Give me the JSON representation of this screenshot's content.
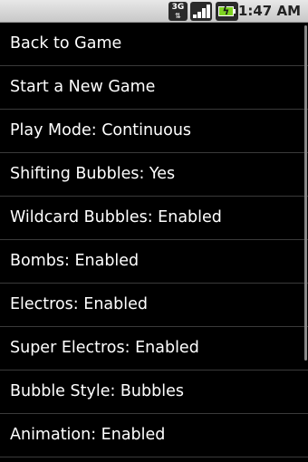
{
  "status_bar": {
    "network_label": "3G",
    "network_arrows": "⇅",
    "signal_level": 1.0,
    "battery_level": 1.0,
    "battery_charging_glyph": "ϟ",
    "time": "1:47 AM",
    "icons": [
      "network-3g-icon",
      "signal-strength-icon",
      "battery-charging-icon"
    ]
  },
  "menu": {
    "items": [
      {
        "label": "Back to Game"
      },
      {
        "label": "Start a New Game"
      },
      {
        "label": "Play Mode: Continuous"
      },
      {
        "label": "Shifting Bubbles: Yes"
      },
      {
        "label": "Wildcard Bubbles: Enabled"
      },
      {
        "label": "Bombs: Enabled"
      },
      {
        "label": "Electros: Enabled"
      },
      {
        "label": "Super Electros: Enabled"
      },
      {
        "label": "Bubble Style: Bubbles"
      },
      {
        "label": "Animation: Enabled"
      }
    ]
  },
  "colors": {
    "background": "#000000",
    "text": "#ffffff",
    "divider": "#3a3a3a",
    "status_bar": "#d8d8d8",
    "battery": "#7ed321"
  }
}
